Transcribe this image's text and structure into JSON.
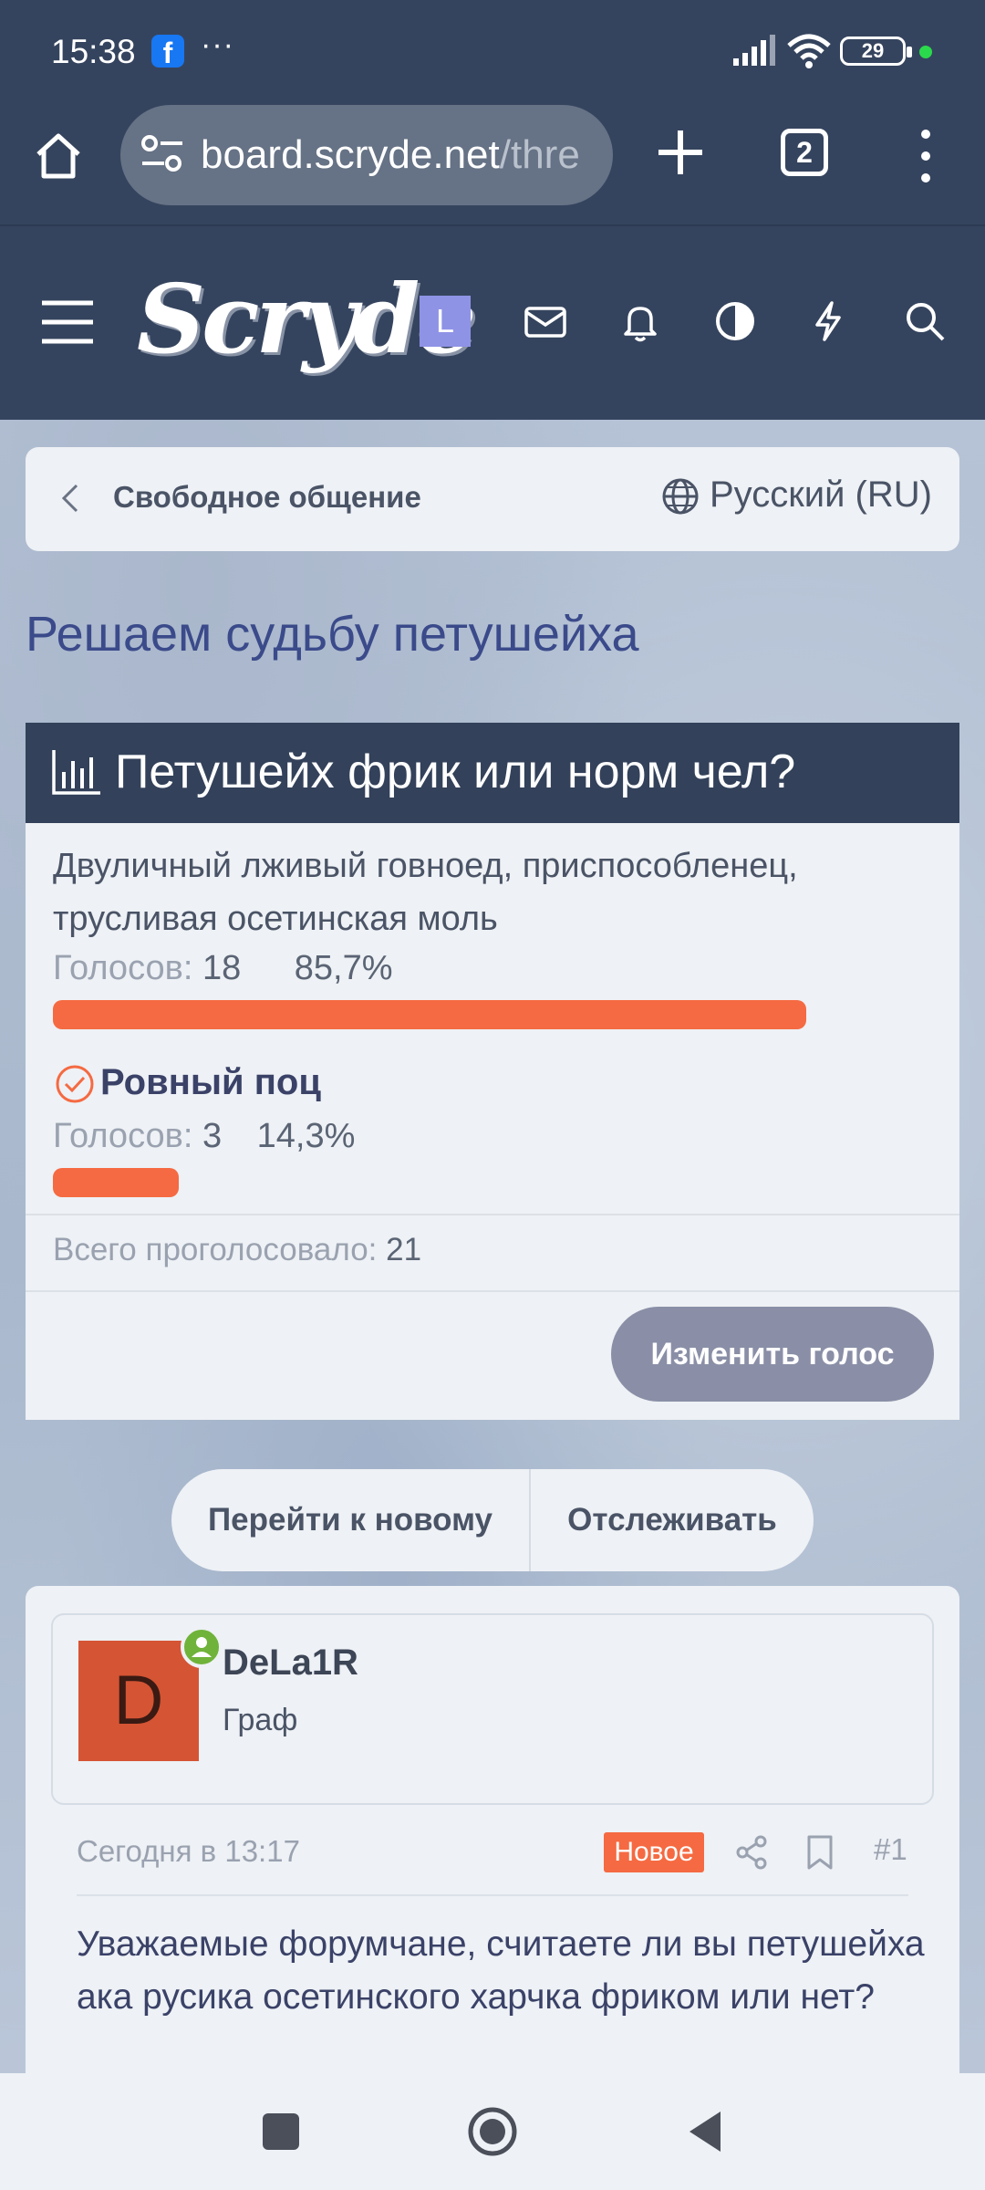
{
  "status_bar": {
    "time": "15:38",
    "notif_dots": "···",
    "battery": "29"
  },
  "browser": {
    "url_main": "board.scryde.net",
    "url_fade": "/thre",
    "tab_count": "2"
  },
  "site": {
    "logo": "Scryde",
    "user_initial": "L"
  },
  "breadcrumb": {
    "label": "Свободное общение",
    "language": "Русский (RU)"
  },
  "thread": {
    "title": "Решаем судьбу петушейха"
  },
  "poll": {
    "question": "Петушейх фрик или норм чел?",
    "options": [
      {
        "label": "Двуличный лживый говноед, приспособленец, трусливая осетинская моль",
        "votes_label": "Голосов:",
        "votes": "18",
        "percent": "85,7%",
        "fraction": 0.857
      },
      {
        "label": "Ровный поц",
        "votes_label": "Голосов:",
        "votes": "3",
        "percent": "14,3%",
        "fraction": 0.143
      }
    ],
    "total_label": "Всего проголосовало:",
    "total": "21",
    "change_vote_label": "Изменить голос"
  },
  "actions": {
    "go_new": "Перейти к новому",
    "watch": "Отслеживать"
  },
  "post": {
    "avatar_letter": "D",
    "username": "DeLa1R",
    "user_title": "Граф",
    "date": "Сегодня в 13:17",
    "new_badge": "Новое",
    "number": "#1",
    "body": "Уважаемые форумчане, считаете ли вы петушейха ака русика осетинского харчка фриком или нет?"
  },
  "colors": {
    "accent_orange": "#f56a42",
    "header_bg": "#35445e",
    "online_green": "#6fb33a"
  }
}
